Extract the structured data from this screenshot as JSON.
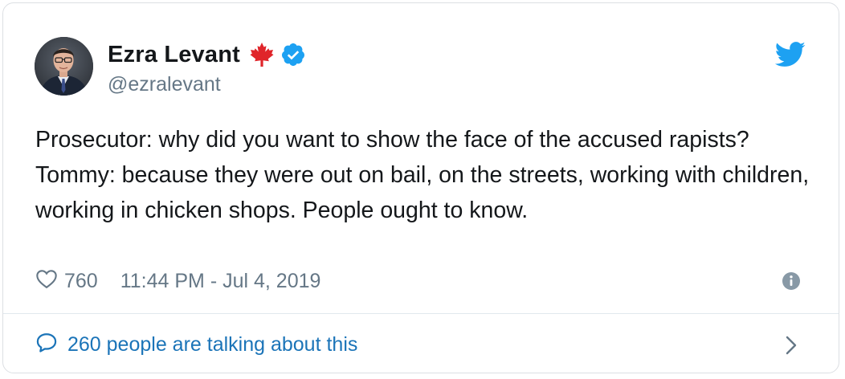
{
  "author": {
    "name": "Ezra Levant",
    "handle": "@ezralevant",
    "flag_icon": "canada-maple-leaf-icon",
    "verified_icon": "verified-badge-icon",
    "avatar": "profile-photo"
  },
  "tweet": {
    "lines": [
      "Prosecutor: why did you want to show the face of the accused rapists?",
      "Tommy: because they were out on bail, on the streets, working with children, working in chicken shops. People ought to know."
    ]
  },
  "meta": {
    "likes": "760",
    "timestamp": "11:44 PM - Jul 4, 2019",
    "like_icon": "heart-outline-icon",
    "info_icon": "info-icon"
  },
  "footer": {
    "talking_text": "260 people are talking about this",
    "talking_icon": "speech-bubble-icon",
    "chevron_icon": "chevron-right-icon"
  },
  "colors": {
    "twitter_blue": "#1da1f2",
    "link_blue": "#1b74b8",
    "maple_red": "#e0252a",
    "text": "#14171a",
    "muted": "#657786"
  }
}
